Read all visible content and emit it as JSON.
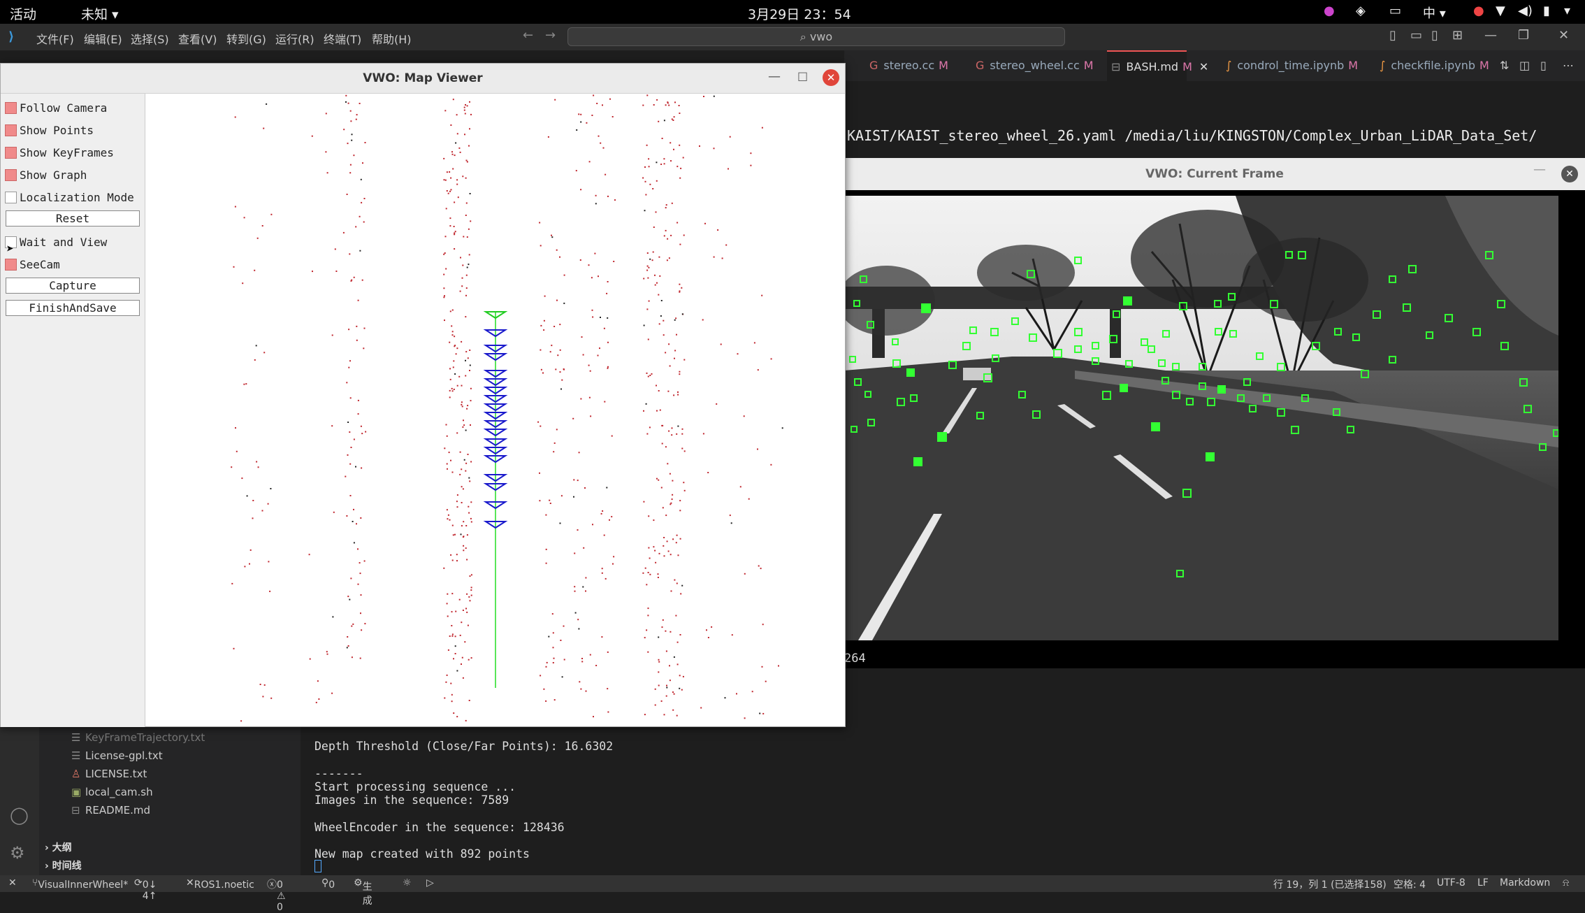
{
  "topbar": {
    "activities": "活动",
    "app_menu": "未知 ▾",
    "clock": "3月29日 23：54",
    "input_method": "中 ▾"
  },
  "vscode": {
    "menu": [
      "文件(F)",
      "编辑(E)",
      "选择(S)",
      "查看(V)",
      "转到(G)",
      "运行(R)",
      "终端(T)",
      "帮助(H)"
    ],
    "search": "⌕ vwo",
    "tabs": [
      {
        "label": "stereo.cc",
        "mark": "M"
      },
      {
        "label": "stereo_wheel.cc",
        "mark": "M"
      },
      {
        "label": "BASH.md",
        "mark": "M",
        "active": true
      },
      {
        "label": "condrol_time.ipynb",
        "mark": "M"
      },
      {
        "label": "checkfile.ipynb",
        "mark": "M"
      }
    ],
    "editor_line": "KAIST/KAIST_stereo_wheel_26.yaml /media/liu/KINGSTON/Complex_Urban_LiDAR_Data_Set/"
  },
  "map_viewer": {
    "title": "VWO: Map Viewer",
    "controls": {
      "follow_camera": "Follow Camera",
      "show_points": "Show Points",
      "show_keyframes": "Show KeyFrames",
      "show_graph": "Show Graph",
      "localization_mode": "Localization Mode",
      "reset": "Reset",
      "wait_and_view": "Wait and View",
      "seecam": "SeeCam",
      "capture": "Capture",
      "finish_and_save": "FinishAndSave"
    },
    "checked": {
      "follow_camera": true,
      "show_points": true,
      "show_keyframes": true,
      "show_graph": true,
      "localization_mode": false,
      "wait_and_view": false,
      "seecam": true
    }
  },
  "current_frame": {
    "title": "VWO: Current Frame",
    "bottom_text": "264"
  },
  "explorer": {
    "files": [
      "KeyFrameTrajectory.txt",
      "License-gpl.txt",
      "LICENSE.txt",
      "local_cam.sh",
      "README.md"
    ],
    "sections": [
      "大纲",
      "时间线"
    ]
  },
  "terminal": {
    "lines": [
      "Depth Threshold (Close/Far Points): 16.6302",
      "",
      "-------",
      "Start processing sequence ...",
      "Images in the sequence: 7589",
      "",
      "WheelEncoder in the sequence: 128436",
      "",
      "New map created with 892 points"
    ]
  },
  "statusbar": {
    "branch": "VisualInnerWheel*",
    "sync": "0↓ 4↑",
    "ros": "ROS1.noetic",
    "problems": "0 ⚠ 0",
    "ports": "0",
    "build": "生成",
    "cursor": "行 19，列 1 (已选择158)",
    "spaces": "空格: 4",
    "encoding": "UTF-8",
    "eol": "LF",
    "language": "Markdown"
  }
}
